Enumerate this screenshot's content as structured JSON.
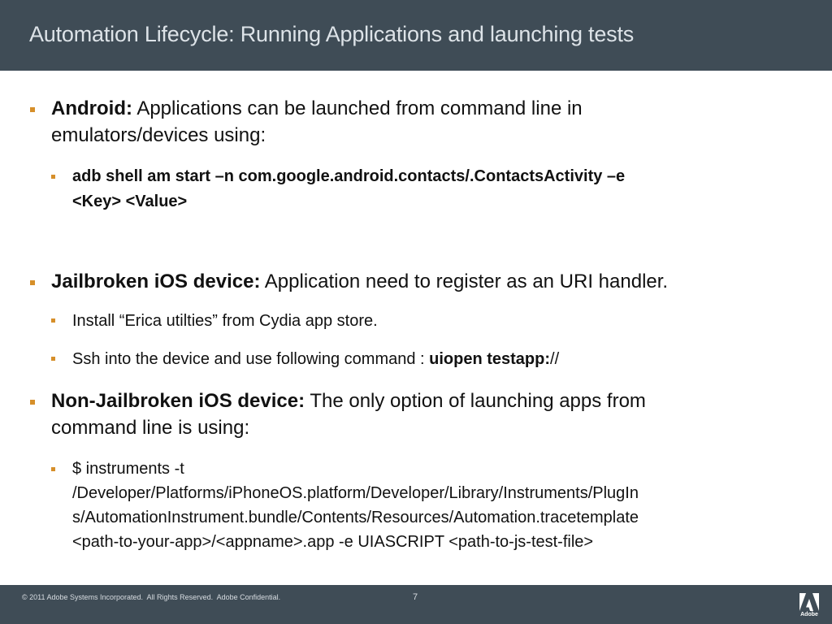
{
  "header": {
    "title": "Automation Lifecycle: Running Applications and launching tests",
    "background": "#3f4c56"
  },
  "bullets": {
    "color": "#d68f2a",
    "android": {
      "label": "Android:",
      "line1": " Applications can be launched from command line in",
      "line2": "emulators/devices using:",
      "sub": {
        "line1": "adb shell am start –n com.google.android.contacts/.ContactsActivity –e",
        "line2": "<Key> <Value>"
      }
    },
    "jailbroken": {
      "label": "Jailbroken iOS device:",
      "text": " Application need to register as an URI handler.",
      "sub1": "Install “Erica utilties” from Cydia app store.",
      "sub2_text": "Ssh into the device and use following command : ",
      "sub2_bold": "uiopen testapp:",
      "sub2_tail": "//"
    },
    "non_jailbroken": {
      "label": "Non-Jailbroken iOS device:",
      "line1": " The only option of launching apps from",
      "line2": "command line is using:",
      "sub": {
        "line1": "$ instruments -t",
        "line2": "/Developer/Platforms/iPhoneOS.platform/Developer/Library/Instruments/PlugIn",
        "line3": "s/AutomationInstrument.bundle/Contents/Resources/Automation.tracetemplate",
        "line4": "<path-to-your-app>/<appname>.app -e UIASCRIPT <path-to-js-test-file>"
      }
    }
  },
  "footer": {
    "copyright": "© 2011 Adobe Systems Incorporated.  All Rights Reserved.  Adobe Confidential.",
    "page_number": "7",
    "logo_text": "Adobe"
  }
}
